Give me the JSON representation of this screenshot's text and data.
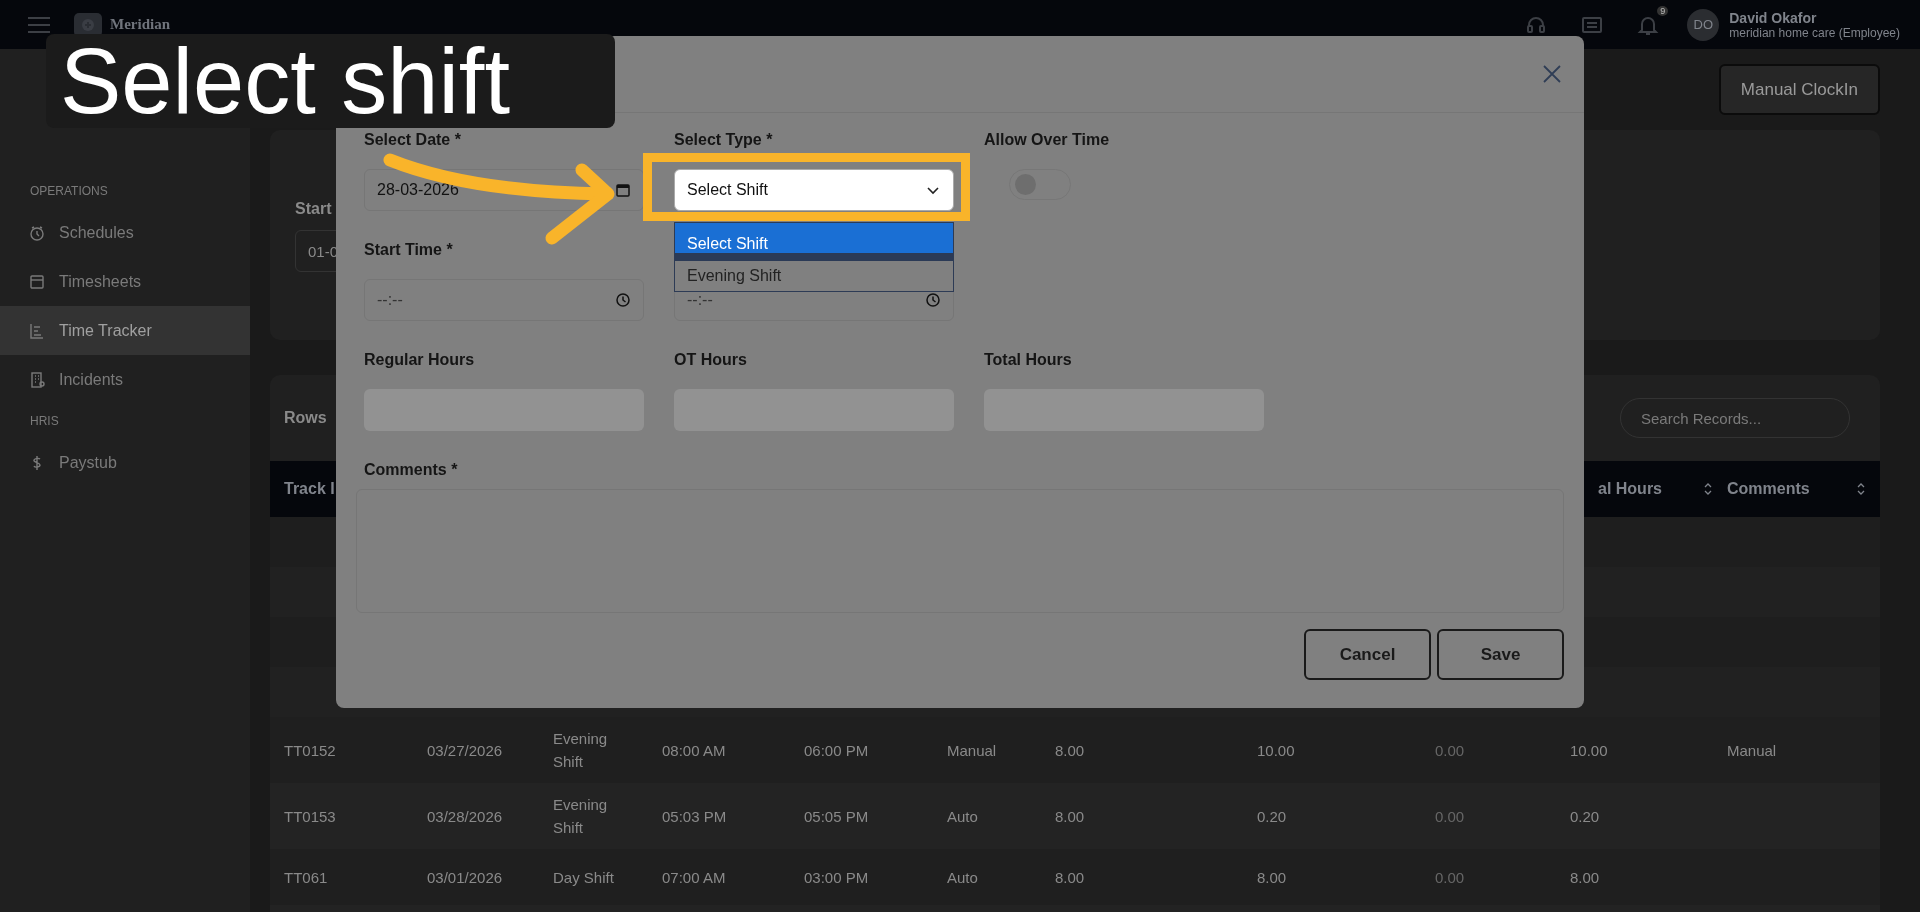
{
  "topbar": {
    "app_name": "Meridian",
    "notification_count": "9",
    "avatar_initials": "DO",
    "user_name": "David Okafor",
    "user_role": "meridian home care (Employee)"
  },
  "sidebar": {
    "items": [
      {
        "kind": "heading",
        "label": "OPERATIONS"
      },
      {
        "kind": "link",
        "label": "Schedules",
        "selected": false
      },
      {
        "kind": "link",
        "label": "Timesheets",
        "selected": false
      },
      {
        "kind": "link",
        "label": "Time Tracker",
        "selected": true
      },
      {
        "kind": "link",
        "label": "Incidents",
        "selected": false
      },
      {
        "kind": "heading",
        "label": "HRIS"
      },
      {
        "kind": "link",
        "label": "Paystub",
        "selected": false
      }
    ]
  },
  "page": {
    "action_button": "Manual ClockIn",
    "filter": {
      "label": "Start",
      "value": "01-0"
    },
    "table": {
      "rows_label": "Rows",
      "search": {
        "placeholder": "Search Records..."
      },
      "columns": [
        {
          "label": "Track I"
        },
        {},
        {},
        {},
        {},
        {},
        {},
        {},
        {},
        {
          "label": "al Hours",
          "sortable": true
        },
        {
          "label": "Comments",
          "sortable": true
        }
      ],
      "rows": [
        [
          "TT0152",
          "03/27/2026",
          "Evening Shift",
          "08:00 AM",
          "06:00 PM",
          "Manual",
          "8.00",
          "10.00",
          "0.00",
          "10.00",
          "Manual"
        ],
        [
          "TT0153",
          "03/28/2026",
          "Evening Shift",
          "05:03 PM",
          "05:05 PM",
          "Auto",
          "8.00",
          "0.20",
          "0.00",
          "0.20",
          ""
        ],
        [
          "TT061",
          "03/01/2026",
          "Day Shift",
          "07:00 AM",
          "03:00 PM",
          "Auto",
          "8.00",
          "8.00",
          "0.00",
          "8.00",
          ""
        ]
      ]
    }
  },
  "dialog": {
    "rows": [
      [
        {
          "kind": "date",
          "label": "Select Date *",
          "value": "28-03-2026"
        },
        {
          "kind": "select",
          "label": "Select Type *",
          "value": "Select Shift",
          "options": [
            {
              "label": "Select Shift",
              "selected": true
            },
            {
              "label": "Evening Shift",
              "selected": false
            }
          ]
        },
        {
          "kind": "toggle",
          "label": "Allow Over Time",
          "on": false
        }
      ],
      [
        {
          "kind": "time",
          "label": "Start Time *",
          "placeholder": "--:--"
        },
        {
          "kind": "time",
          "placeholder": "--:--"
        }
      ],
      [
        {
          "kind": "readonly",
          "label": "Regular Hours"
        },
        {
          "kind": "readonly",
          "label": "OT Hours"
        },
        {
          "kind": "readonly",
          "label": "Total Hours"
        }
      ]
    ],
    "comments_label": "Comments *",
    "buttons": [
      "Cancel",
      "Save"
    ]
  },
  "tutorial": {
    "caption": "Select shift"
  }
}
